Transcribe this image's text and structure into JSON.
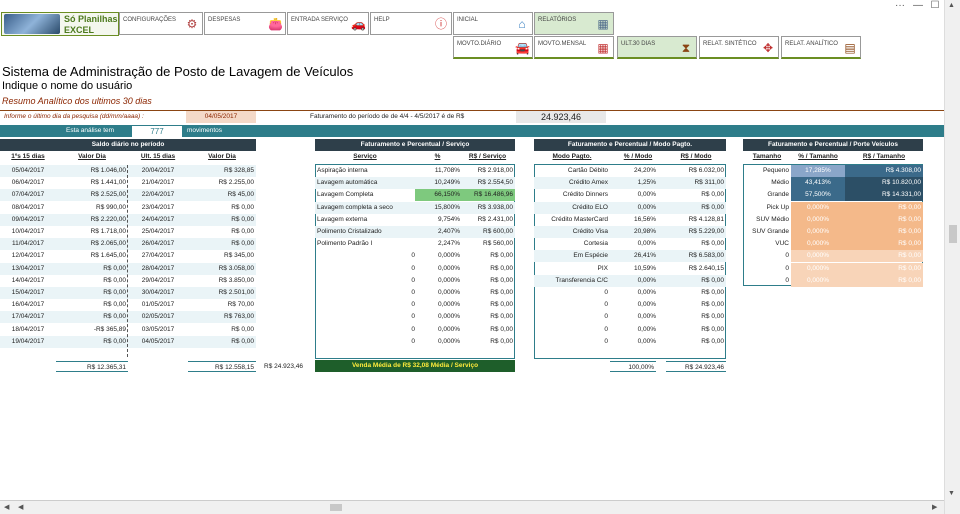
{
  "window": {
    "controls": [
      "···",
      "—",
      "☐"
    ]
  },
  "logo": {
    "line1": "Só Planilhas",
    "line2": "EXCEL"
  },
  "menu_row1": [
    {
      "label": "CONFIGURAÇÕES",
      "icon": "⚙"
    },
    {
      "label": "DESPESAS",
      "icon": "👛"
    },
    {
      "label": "ENTRADA SERVIÇO",
      "icon": "🚗"
    },
    {
      "label": "HELP",
      "icon": "ⓘ"
    },
    {
      "label": "INICIAL",
      "icon": "⌂"
    },
    {
      "label": "RELATÓRIOS",
      "icon": "▦"
    }
  ],
  "menu_row2": [
    {
      "label": "MOVTO.DIÁRIO",
      "icon": "🚘"
    },
    {
      "label": "MOVTO.MENSAL",
      "icon": "▦"
    },
    {
      "label": "ULT.30 DIAS",
      "icon": "⧗"
    },
    {
      "label": "RELAT. SINTÉTICO",
      "icon": "✥"
    },
    {
      "label": "RELAT. ANALÍTICO",
      "icon": "▤"
    }
  ],
  "page": {
    "title": "Sistema de Administração de Posto de Lavagem de Veículos",
    "user": "Indique o nome do usuário",
    "subtitle": "Resumo Analítico dos ultimos 30 dias",
    "date_prompt": "Informe o último dia da pesquisa (dd/mm/aaaa) :",
    "date_value": "04/05/2017",
    "fat_label": "Faturamento do período de de 4/4 - 4/5/2017 é de R$",
    "fat_value": "24.923,46",
    "analysis_prefix": "Esta análise tem",
    "analysis_count": "777",
    "analysis_suffix": "movimentos"
  },
  "saldo": {
    "header": "Saldo diário no período",
    "columns": [
      "1ºs 15 dias",
      "Valor Dia",
      "Ult. 15 dias",
      "Valor Dia"
    ],
    "rows": [
      [
        "05/04/2017",
        "R$ 1.046,00",
        "20/04/2017",
        "R$ 328,85"
      ],
      [
        "06/04/2017",
        "R$ 1.441,00",
        "21/04/2017",
        "R$ 2.255,00"
      ],
      [
        "07/04/2017",
        "R$ 2.525,00",
        "22/04/2017",
        "R$ 45,00"
      ],
      [
        "08/04/2017",
        "R$ 990,00",
        "23/04/2017",
        "R$ 0,00"
      ],
      [
        "09/04/2017",
        "R$ 2.220,00",
        "24/04/2017",
        "R$ 0,00"
      ],
      [
        "10/04/2017",
        "R$ 1.718,00",
        "25/04/2017",
        "R$ 0,00"
      ],
      [
        "11/04/2017",
        "R$ 2.065,00",
        "26/04/2017",
        "R$ 0,00"
      ],
      [
        "12/04/2017",
        "R$ 1.645,00",
        "27/04/2017",
        "R$ 345,00"
      ],
      [
        "13/04/2017",
        "R$ 0,00",
        "28/04/2017",
        "R$ 3.058,00"
      ],
      [
        "14/04/2017",
        "R$ 0,00",
        "29/04/2017",
        "R$ 3.850,00"
      ],
      [
        "15/04/2017",
        "R$ 0,00",
        "30/04/2017",
        "R$ 2.501,00"
      ],
      [
        "16/04/2017",
        "R$ 0,00",
        "01/05/2017",
        "R$ 70,00"
      ],
      [
        "17/04/2017",
        "R$ 0,00",
        "02/05/2017",
        "R$ 763,00"
      ],
      [
        "18/04/2017",
        "-R$ 365,89",
        "03/05/2017",
        "R$ 0,00"
      ],
      [
        "19/04/2017",
        "R$ 0,00",
        "04/05/2017",
        "R$ 0,00"
      ]
    ],
    "total1": "R$ 12.365,31",
    "total2": "R$ 12.558,15",
    "grand_total": "R$ 24.923,46"
  },
  "servico": {
    "header": "Faturamento e Percentual / Serviço",
    "columns": [
      "Serviço",
      "%",
      "R$ / Serviço"
    ],
    "rows": [
      [
        "Aspiração interna",
        "11,708%",
        "R$ 2.918,00"
      ],
      [
        "Lavagem automática",
        "10,249%",
        "R$ 2.554,50"
      ],
      [
        "Lavagem Completa",
        "66,150%",
        "R$ 16.486,96"
      ],
      [
        "Lavagem completa a seco",
        "15,800%",
        "R$ 3.938,00"
      ],
      [
        "Lavagem externa",
        "9,754%",
        "R$ 2.431,00"
      ],
      [
        "Polimento Cristalizado",
        "2,407%",
        "R$ 600,00"
      ],
      [
        "Polimento Padrão I",
        "2,247%",
        "R$ 560,00"
      ],
      [
        "0",
        "0,000%",
        "R$ 0,00"
      ],
      [
        "0",
        "0,000%",
        "R$ 0,00"
      ],
      [
        "0",
        "0,000%",
        "R$ 0,00"
      ],
      [
        "0",
        "0,000%",
        "R$ 0,00"
      ],
      [
        "0",
        "0,000%",
        "R$ 0,00"
      ],
      [
        "0",
        "0,000%",
        "R$ 0,00"
      ],
      [
        "0",
        "0,000%",
        "R$ 0,00"
      ],
      [
        "0",
        "0,000%",
        "R$ 0,00"
      ]
    ],
    "footer": "Venda Média de R$ 32,08 Média / Serviço"
  },
  "pagto": {
    "header": "Faturamento e Percentual / Modo Pagto.",
    "columns": [
      "Modo Pagto.",
      "% / Modo",
      "R$ / Modo"
    ],
    "rows": [
      [
        "Cartão Débito",
        "24,20%",
        "R$ 6.032,00"
      ],
      [
        "Crédito Amex",
        "1,25%",
        "R$ 311,00"
      ],
      [
        "Crédito Dinners",
        "0,00%",
        "R$ 0,00"
      ],
      [
        "Crédito ELO",
        "0,00%",
        "R$ 0,00"
      ],
      [
        "Crédito MasterCard",
        "16,56%",
        "R$ 4.128,81"
      ],
      [
        "Crédito Visa",
        "20,98%",
        "R$ 5.229,00"
      ],
      [
        "Cortesia",
        "0,00%",
        "R$ 0,00"
      ],
      [
        "Em Espécie",
        "26,41%",
        "R$ 6.583,00"
      ],
      [
        "PIX",
        "10,59%",
        "R$ 2.640,15"
      ],
      [
        "Transferencia C/C",
        "0,00%",
        "R$ 0,00"
      ],
      [
        "0",
        "0,00%",
        "R$ 0,00"
      ],
      [
        "0",
        "0,00%",
        "R$ 0,00"
      ],
      [
        "0",
        "0,00%",
        "R$ 0,00"
      ],
      [
        "0",
        "0,00%",
        "R$ 0,00"
      ],
      [
        "0",
        "0,00%",
        "R$ 0,00"
      ]
    ],
    "total_pct": "100,00%",
    "total_value": "R$ 24.923,46"
  },
  "porte": {
    "header": "Faturamento e Percentual / Porte Veículos",
    "columns": [
      "Tamanho",
      "% / Tamanho",
      "R$ / Tamanho"
    ],
    "rows": [
      [
        "Pequeno",
        "17,285%",
        "R$ 4.308,00"
      ],
      [
        "Médio",
        "43,413%",
        "R$ 10.820,00"
      ],
      [
        "Grande",
        "57,500%",
        "R$ 14.331,00"
      ],
      [
        "Pick Up",
        "0,000%",
        "R$ 0,00"
      ],
      [
        "SUV Médio",
        "0,000%",
        "R$ 0,00"
      ],
      [
        "SUV Grande",
        "0,000%",
        "R$ 0,00"
      ],
      [
        "VUC",
        "0,000%",
        "R$ 0,00"
      ],
      [
        "0",
        "0,000%",
        "R$ 0,00"
      ],
      [
        "0",
        "0,000%",
        "R$ 0,00"
      ],
      [
        "0",
        "0,000%",
        "R$ 0,00"
      ]
    ]
  },
  "colors": {
    "header_dark": "#2e3f4a",
    "teal_bar": "#2e7d8a",
    "green_hl": "#7ec97e",
    "blue_mid": "#8aa6c9",
    "blue_dark": "#3b6a8a",
    "peach": "#f4b98a"
  }
}
